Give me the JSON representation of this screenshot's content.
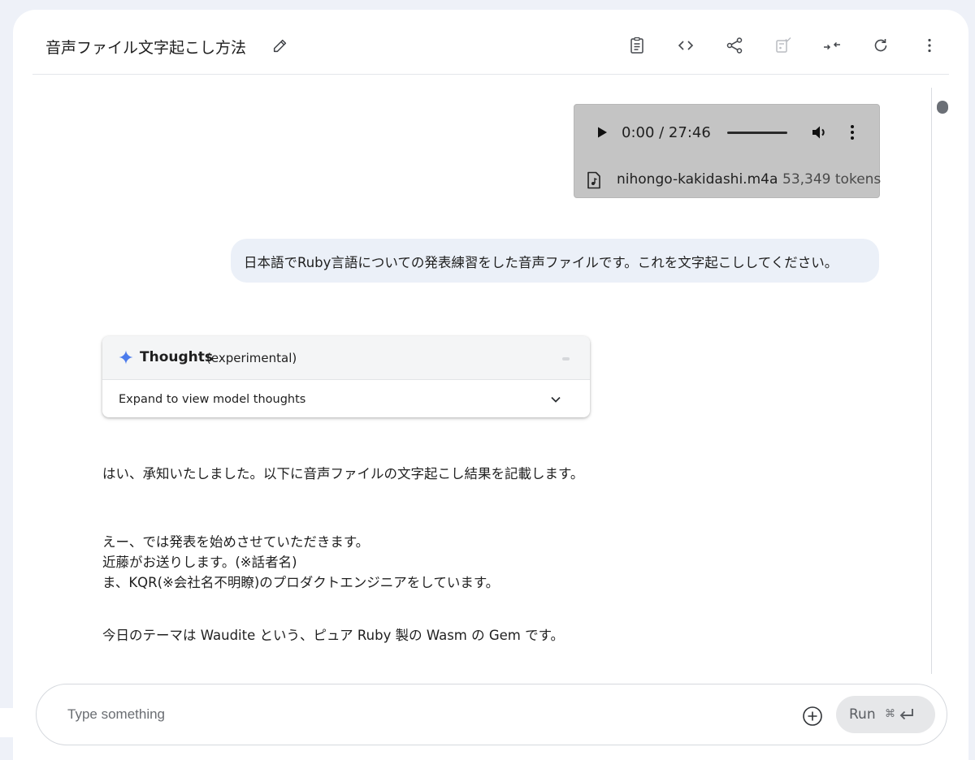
{
  "header": {
    "title": "音声ファイル文字起こし方法",
    "icons": [
      "edit-icon",
      "clipboard-icon",
      "code-icon",
      "share-icon",
      "compare-icon",
      "compress-icon",
      "refresh-icon",
      "more-vert-icon"
    ]
  },
  "audio": {
    "time": "0:00 / 27:46",
    "file_name": "nihongo-kakidashi.m4a",
    "tokens": "53,349 tokens"
  },
  "user_message": "日本語でRuby言語についての発表練習をした音声ファイルです。これを文字起こししてください。",
  "thoughts": {
    "title": "Thoughts",
    "subtitle": "(experimental)",
    "expand_label": "Expand to view model thoughts"
  },
  "response": {
    "intro": "はい、承知いたしました。以下に音声ファイルの文字起こし結果を記載します。",
    "line1": "えー、では発表を始めさせていただきます。",
    "line2": "近藤がお送りします。(※話者名)",
    "line3": "ま、KQR(※会社名不明瞭)のプロダクトエンジニアをしています。",
    "line4": "今日のテーマは Waudite という、ピュア Ruby 製の Wasm の Gem です。"
  },
  "input": {
    "placeholder": "Type something",
    "run_label": "Run",
    "run_shortcut": "⌘"
  },
  "colors": {
    "background": "#eef1f8",
    "user_bubble": "#ebf0f8",
    "audio_bg": "#c4c4c4",
    "spark": "#4b7bec"
  }
}
